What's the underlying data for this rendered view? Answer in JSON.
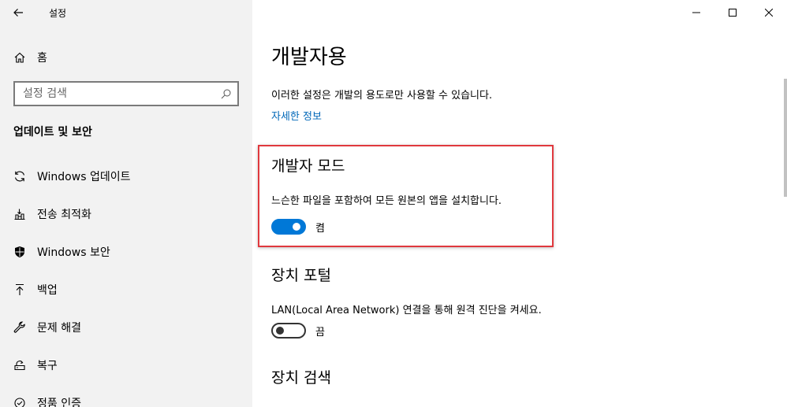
{
  "app": {
    "title": "설정"
  },
  "sidebar": {
    "home_label": "홈",
    "search_placeholder": "설정 검색",
    "section_title": "업데이트 및 보안",
    "items": [
      {
        "label": "Windows 업데이트",
        "icon": "sync-icon"
      },
      {
        "label": "전송 최적화",
        "icon": "delivery-optimization-icon"
      },
      {
        "label": "Windows 보안",
        "icon": "shield-icon"
      },
      {
        "label": "백업",
        "icon": "backup-arrow-icon"
      },
      {
        "label": "문제 해결",
        "icon": "wrench-icon"
      },
      {
        "label": "복구",
        "icon": "recovery-icon"
      },
      {
        "label": "정품 인증",
        "icon": "activation-icon"
      }
    ]
  },
  "main": {
    "title": "개발자용",
    "description": "이러한 설정은 개발의 용도로만 사용할 수 있습니다.",
    "more_info_link": "자세한 정보",
    "developer_mode": {
      "title": "개발자 모드",
      "description": "느슨한 파일을 포함하여 모든 원본의 앱을 설치합니다.",
      "state": "켬",
      "enabled": true
    },
    "device_portal": {
      "title": "장치 포털",
      "description": "LAN(Local Area Network) 연결을 통해 원격 진단을 켜세요.",
      "state": "끔",
      "enabled": false
    },
    "device_discovery": {
      "title": "장치 검색"
    }
  },
  "colors": {
    "accent": "#0078d7",
    "link": "#0067b8",
    "highlight_border": "#e0393e",
    "sidebar_bg": "#f2f2f2"
  }
}
